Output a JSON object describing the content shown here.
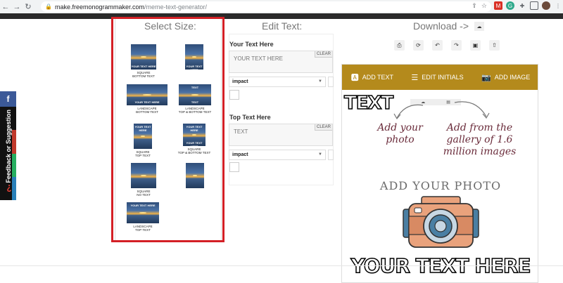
{
  "browser": {
    "url_host": "make.freemonogrammaker.com",
    "url_path": "/meme-text-generator/"
  },
  "feedback": {
    "label": "Feedback or Suggestion",
    "social": "f"
  },
  "columns": {
    "select_size": "Select Size:",
    "edit_text": "Edit Text:",
    "download": "Download ->"
  },
  "sizes": [
    {
      "label": "SQUARE\nBOTTOM TEXT",
      "caption": "YOUR TEXT HERE"
    },
    {
      "label": "",
      "caption": "YOUR TEXT HERE"
    },
    {
      "label": "LANDSCAPE\nBOTTOM TEXT",
      "caption": "YOUR TEXT HERE"
    },
    {
      "label": "LANDSCAPE\nTOP & BOTTOM TEXT",
      "caption": "TEXT"
    },
    {
      "label": "SQUARE\nTOP TEXT",
      "caption": "YOUR TEXT HERE"
    },
    {
      "label": "SQUARE\nTOP & BOTTOM TEXT",
      "caption": "YOUR TEXT HERE"
    },
    {
      "label": "SQUARE\nNO TEXT",
      "caption": ""
    },
    {
      "label": "",
      "caption": ""
    },
    {
      "label": "LANDSCAPE\nTOP TEXT",
      "caption": "YOUR TEXT HERE"
    }
  ],
  "edit": {
    "field1_label": "Your Text Here",
    "field1_value": "YOUR TEXT HERE",
    "field2_label": "Top Text Here",
    "field2_value": "TEXT",
    "clear": "CLEAR",
    "font": "impact"
  },
  "toolbar": {
    "add_text": "ADD TEXT",
    "edit_initials": "EDIT INITIALS",
    "add_image": "ADD IMAGE"
  },
  "canvas": {
    "top_text": "TEXT",
    "hint_left": "Add your photo",
    "hint_right": "Add from the gallery of 1.6 million images",
    "add_photo": "ADD YOUR PHOTO",
    "bottom_text": "YOUR TEXT HERE"
  },
  "colors": {
    "highlight": "#d42026",
    "toolbar": "#b48a1c",
    "script": "#6a2b3a"
  }
}
